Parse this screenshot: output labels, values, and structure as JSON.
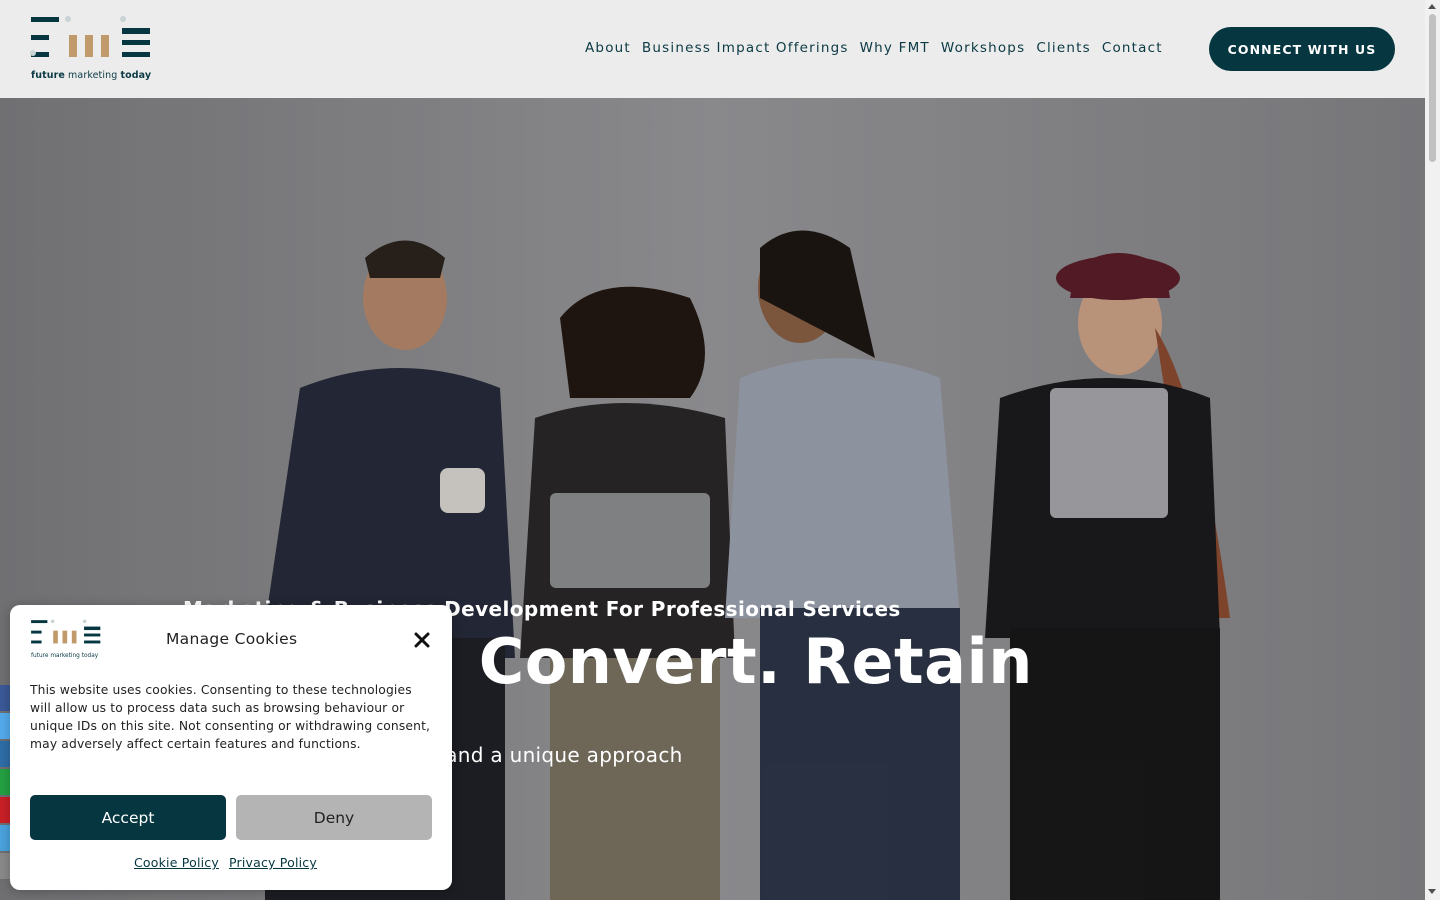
{
  "header": {
    "logo_text_bold1": "future",
    "logo_text_mid": " marketing ",
    "logo_text_bold2": "today",
    "nav": [
      {
        "label": "About"
      },
      {
        "label": "Business Impact Offerings"
      },
      {
        "label": "Why FMT"
      },
      {
        "label": "Workshops"
      },
      {
        "label": "Clients"
      },
      {
        "label": "Contact"
      }
    ],
    "cta_label": "CONNECT WITH US"
  },
  "hero": {
    "subtitle": "Marketing & Business Development For Professional Services",
    "title": "Attract. Convert. Retain",
    "description": "Clear thought leadership and a unique approach"
  },
  "cookie": {
    "logo_text": "future marketing today",
    "title": "Manage Cookies",
    "body": "This website uses cookies. Consenting to these technologies will allow us to process data such as browsing behaviour or unique IDs on this site. Not consenting or withdrawing consent, may adversely affect certain features and functions.",
    "accept_label": "Accept",
    "deny_label": "Deny",
    "cookie_policy_label": "Cookie Policy",
    "privacy_policy_label": "Privacy Policy"
  },
  "colors": {
    "brand_dark": "#063740",
    "brand_tan": "#c19a6b",
    "header_bg": "#ececec"
  },
  "social": [
    {
      "icon": "facebook-icon",
      "color": "#3b5998"
    },
    {
      "icon": "twitter-icon",
      "color": "#55acee"
    },
    {
      "icon": "linkedin-icon",
      "color": "#2f6ea8"
    },
    {
      "icon": "whatsapp-icon",
      "color": "#25a244"
    },
    {
      "icon": "pinterest-icon",
      "color": "#cb2027"
    },
    {
      "icon": "telegram-icon",
      "color": "#4aa3de"
    },
    {
      "icon": "email-icon",
      "color": "#8a8a8a"
    }
  ]
}
